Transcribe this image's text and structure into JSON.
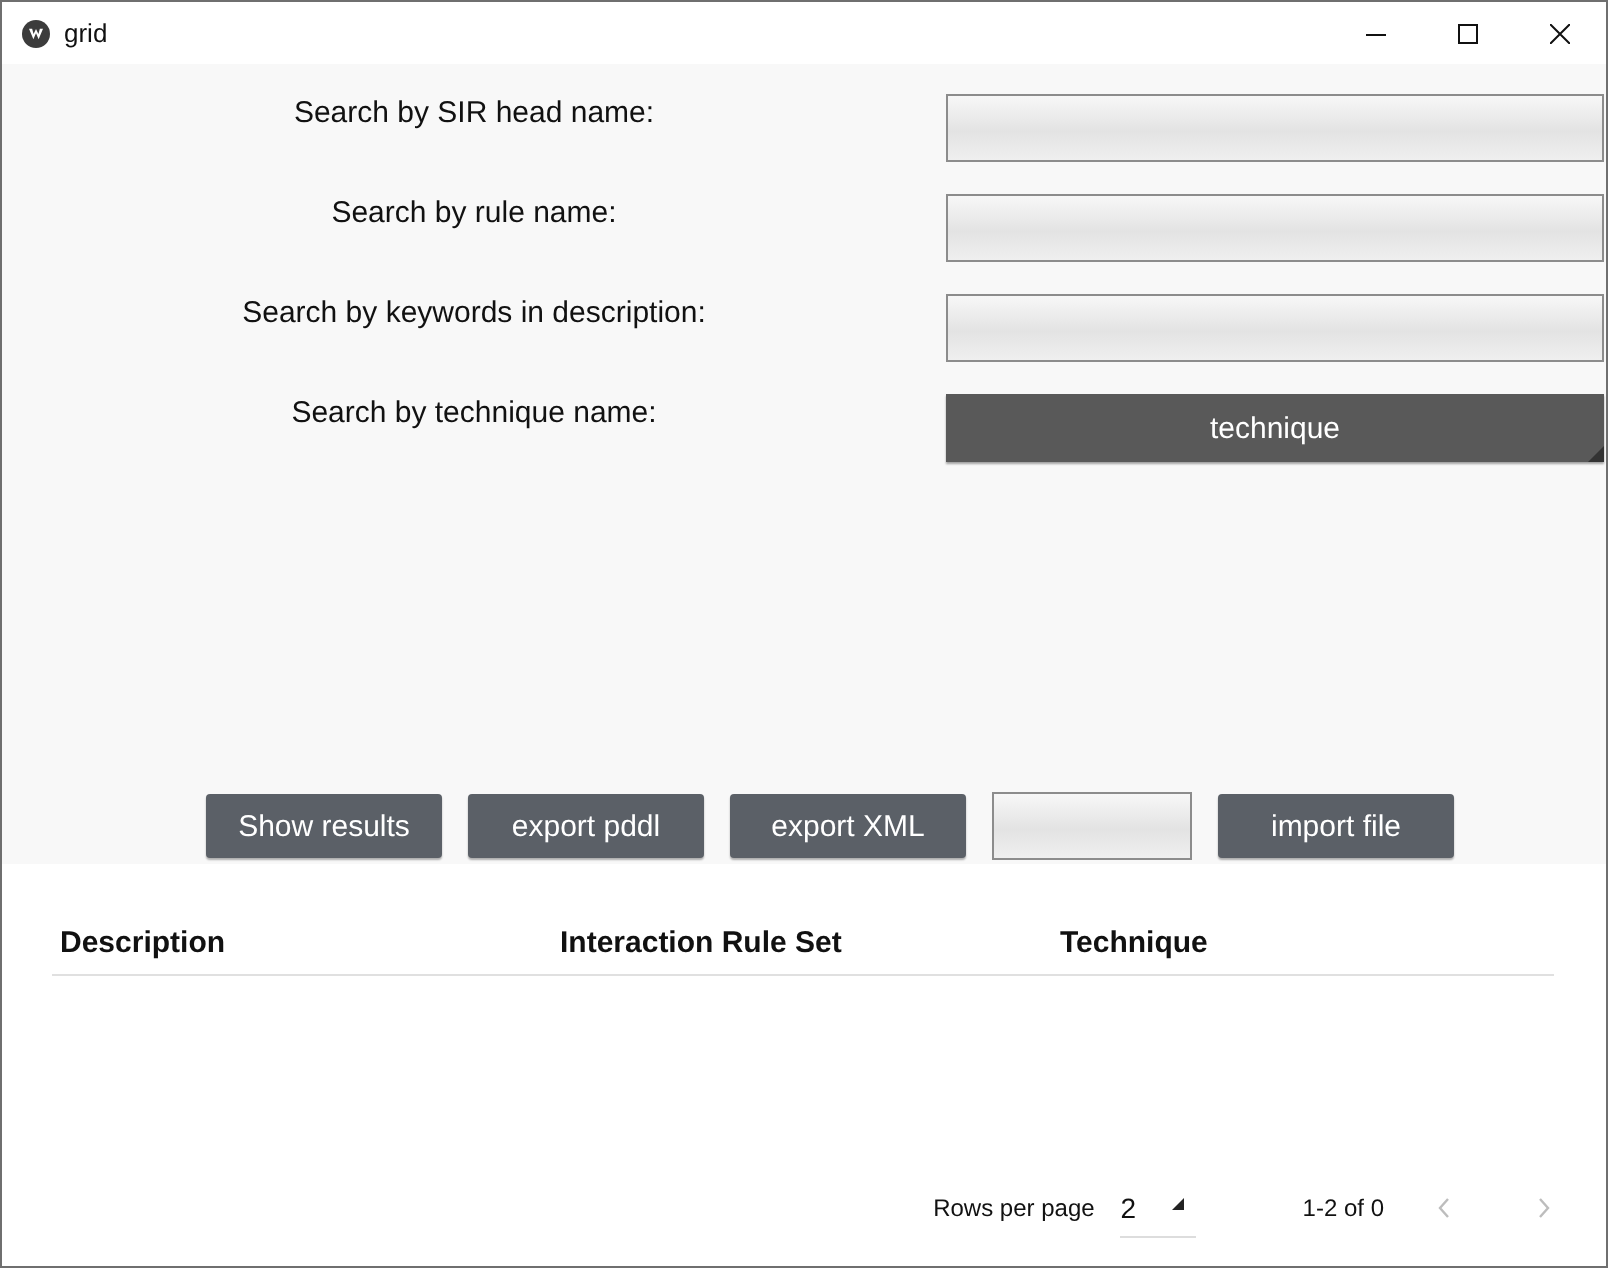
{
  "window": {
    "title": "grid"
  },
  "search_fields": [
    {
      "label": "Search by SIR head name:",
      "kind": "text"
    },
    {
      "label": "Search by rule name:",
      "kind": "text"
    },
    {
      "label": "Search by keywords in description:",
      "kind": "text"
    },
    {
      "label": "Search by technique name:",
      "kind": "dropdown",
      "value": "technique"
    }
  ],
  "actions": [
    {
      "kind": "button",
      "label": "Show results"
    },
    {
      "kind": "button",
      "label": "export pddl"
    },
    {
      "kind": "button",
      "label": "export XML"
    },
    {
      "kind": "field"
    },
    {
      "kind": "button",
      "label": "import file"
    }
  ],
  "table": {
    "columns": [
      "Description",
      "Interaction Rule Set",
      "Technique"
    ]
  },
  "pagination": {
    "rows_per_page_label": "Rows per page",
    "rows_per_page": "2",
    "range": "1-2 of 0",
    "prev_disabled": true,
    "next_disabled": true
  }
}
